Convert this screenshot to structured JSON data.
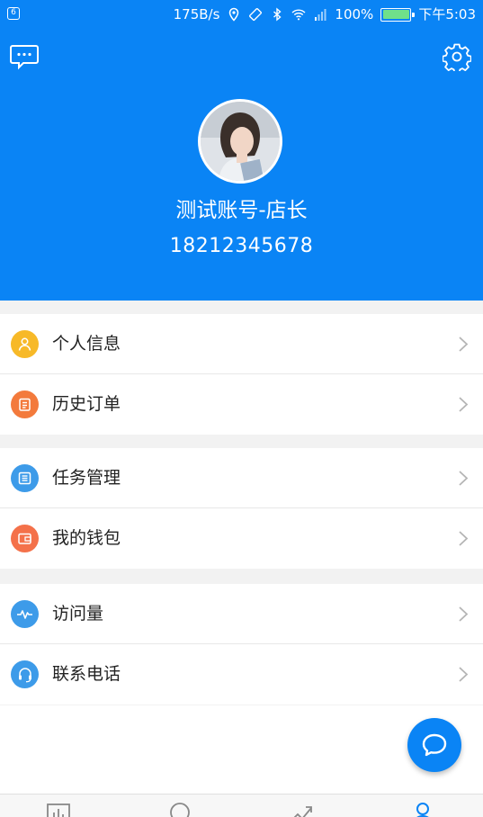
{
  "status_bar": {
    "notification_badge": "6",
    "net_speed": "175B/s",
    "battery_text": "100%",
    "battery_level": 1.0,
    "time": "下午5:03",
    "icons": [
      "location-icon",
      "vibrate-icon",
      "bluetooth-icon",
      "wifi-icon",
      "signal-icon",
      "battery-icon"
    ]
  },
  "header": {
    "left_icon": "message-icon",
    "right_icon": "gear-icon",
    "user_name": "测试账号-店长",
    "phone": "18212345678"
  },
  "menu_groups": [
    [
      {
        "label": "个人信息",
        "icon": "person-icon",
        "color": "#f7b928"
      },
      {
        "label": "历史订单",
        "icon": "order-icon",
        "color": "#f37a3c"
      }
    ],
    [
      {
        "label": "任务管理",
        "icon": "task-list-icon",
        "color": "#3d9be9"
      },
      {
        "label": "我的钱包",
        "icon": "wallet-icon",
        "color": "#f4714a"
      }
    ],
    [
      {
        "label": "访问量",
        "icon": "pulse-icon",
        "color": "#3d9be9"
      },
      {
        "label": "联系电话",
        "icon": "headset-icon",
        "color": "#3d9be9"
      }
    ]
  ],
  "fab": {
    "icon": "chat-bubble-icon"
  },
  "tabbar": {
    "tabs": [
      {
        "icon": "bar-chart-icon",
        "active": false
      },
      {
        "icon": "comment-icon",
        "active": false
      },
      {
        "icon": "trend-icon",
        "active": false
      },
      {
        "icon": "user-icon",
        "active": true
      }
    ]
  },
  "colors": {
    "primary": "#0a84f5",
    "background": "#f2f2f2",
    "text": "#222222",
    "chevron": "#b5b5b5",
    "battery": "#6fe08a"
  }
}
